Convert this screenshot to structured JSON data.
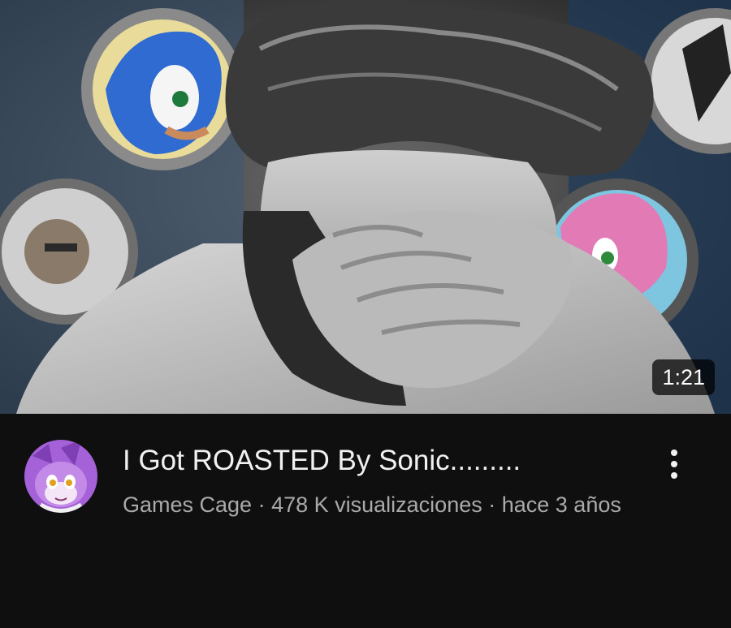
{
  "video": {
    "duration": "1:21",
    "title": "I Got ROASTED By Sonic.........",
    "channel": "Games Cage",
    "separator": " · ",
    "views": "478 K visualizaciones",
    "age": "hace 3 años"
  },
  "icons": {
    "more": "more-vert-icon"
  },
  "colors": {
    "background": "#0f0f0f",
    "title": "#f1f1f1",
    "subtitle": "#aaaaaa",
    "avatar_bg": "#a561d8"
  }
}
